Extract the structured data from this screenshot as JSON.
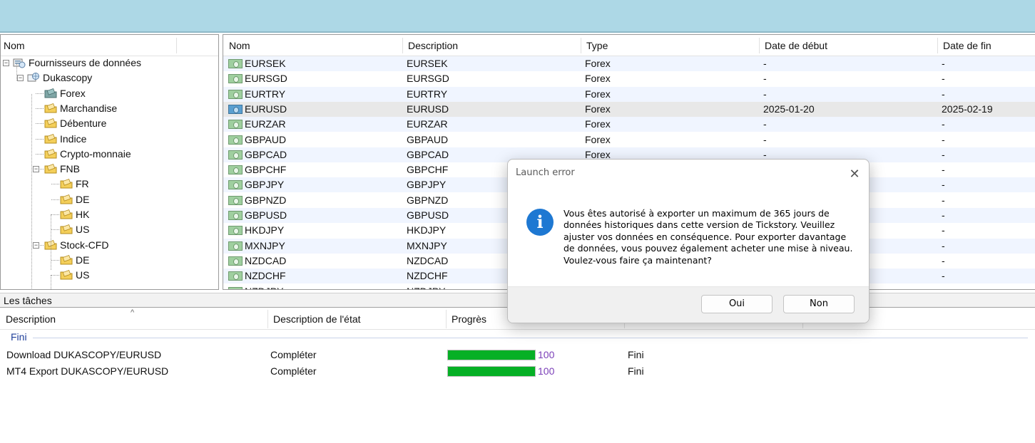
{
  "tree": {
    "header": "Nom",
    "items": [
      {
        "label": "Fournisseurs de données",
        "icon": "data-sources-icon"
      },
      {
        "label": "Dukascopy",
        "icon": "provider-icon"
      },
      {
        "label": "Forex",
        "icon": "folder-forex-icon"
      },
      {
        "label": "Marchandise",
        "icon": "folder-icon"
      },
      {
        "label": "Débenture",
        "icon": "folder-icon"
      },
      {
        "label": "Indice",
        "icon": "folder-icon"
      },
      {
        "label": "Crypto-monnaie",
        "icon": "folder-icon"
      },
      {
        "label": "FNB",
        "icon": "folder-icon"
      },
      {
        "label": "FR",
        "icon": "folder-icon"
      },
      {
        "label": "DE",
        "icon": "folder-icon"
      },
      {
        "label": "HK",
        "icon": "folder-icon"
      },
      {
        "label": "US",
        "icon": "folder-icon"
      },
      {
        "label": "Stock-CFD",
        "icon": "folder-icon"
      },
      {
        "label": "DE",
        "icon": "folder-icon"
      },
      {
        "label": "US",
        "icon": "folder-icon"
      }
    ]
  },
  "grid": {
    "columns": [
      "Nom",
      "Description",
      "Type",
      "Date de début",
      "Date de fin"
    ],
    "rows": [
      {
        "name": "EURSEK",
        "description": "EURSEK",
        "type": "Forex",
        "start": "-",
        "end": "-"
      },
      {
        "name": "EURSGD",
        "description": "EURSGD",
        "type": "Forex",
        "start": "-",
        "end": "-"
      },
      {
        "name": "EURTRY",
        "description": "EURTRY",
        "type": "Forex",
        "start": "-",
        "end": "-"
      },
      {
        "name": "EURUSD",
        "description": "EURUSD",
        "type": "Forex",
        "start": "2025-01-20",
        "end": "2025-02-19"
      },
      {
        "name": "EURZAR",
        "description": "EURZAR",
        "type": "Forex",
        "start": "-",
        "end": "-"
      },
      {
        "name": "GBPAUD",
        "description": "GBPAUD",
        "type": "Forex",
        "start": "-",
        "end": "-"
      },
      {
        "name": "GBPCAD",
        "description": "GBPCAD",
        "type": "Forex",
        "start": "-",
        "end": "-"
      },
      {
        "name": "GBPCHF",
        "description": "GBPCHF",
        "type": "",
        "start": "",
        "end": "-"
      },
      {
        "name": "GBPJPY",
        "description": "GBPJPY",
        "type": "",
        "start": "",
        "end": "-"
      },
      {
        "name": "GBPNZD",
        "description": "GBPNZD",
        "type": "",
        "start": "",
        "end": "-"
      },
      {
        "name": "GBPUSD",
        "description": "GBPUSD",
        "type": "",
        "start": "",
        "end": "-"
      },
      {
        "name": "HKDJPY",
        "description": "HKDJPY",
        "type": "",
        "start": "",
        "end": "-"
      },
      {
        "name": "MXNJPY",
        "description": "MXNJPY",
        "type": "",
        "start": "",
        "end": "-"
      },
      {
        "name": "NZDCAD",
        "description": "NZDCAD",
        "type": "",
        "start": "",
        "end": "-"
      },
      {
        "name": "NZDCHF",
        "description": "NZDCHF",
        "type": "",
        "start": "",
        "end": "-"
      },
      {
        "name": "NZDJPY",
        "description": "NZDJPY",
        "type": "",
        "start": "",
        "end": ""
      }
    ],
    "selected_index": 3
  },
  "tasks": {
    "title": "Les tâches",
    "columns": [
      "Description",
      "Description de l'état",
      "Progrès"
    ],
    "group": "Fini",
    "rows": [
      {
        "description": "Download DUKASCOPY/EURUSD",
        "state": "Compléter",
        "progress": 100,
        "progress_label": "100",
        "status": "Fini"
      },
      {
        "description": "MT4 Export DUKASCOPY/EURUSD",
        "state": "Compléter",
        "progress": 100,
        "progress_label": "100",
        "status": "Fini"
      }
    ]
  },
  "dialog": {
    "title": "Launch error",
    "message": "Vous êtes autorisé à exporter un maximum de 365 jours de données historiques dans cette version de Tickstory. Veuillez ajuster vos données en conséquence. Pour exporter davantage de données, vous pouvez également acheter une mise à niveau. Voulez-vous faire ça maintenant?",
    "yes_label": "Oui",
    "no_label": "Non",
    "icon": "info-icon"
  },
  "colors": {
    "topbar": "#add8e6",
    "progress_fill": "#06b025",
    "progress_text": "#7b3fb8",
    "group_text": "#1f3f9a",
    "info_icon": "#1e78d2"
  }
}
